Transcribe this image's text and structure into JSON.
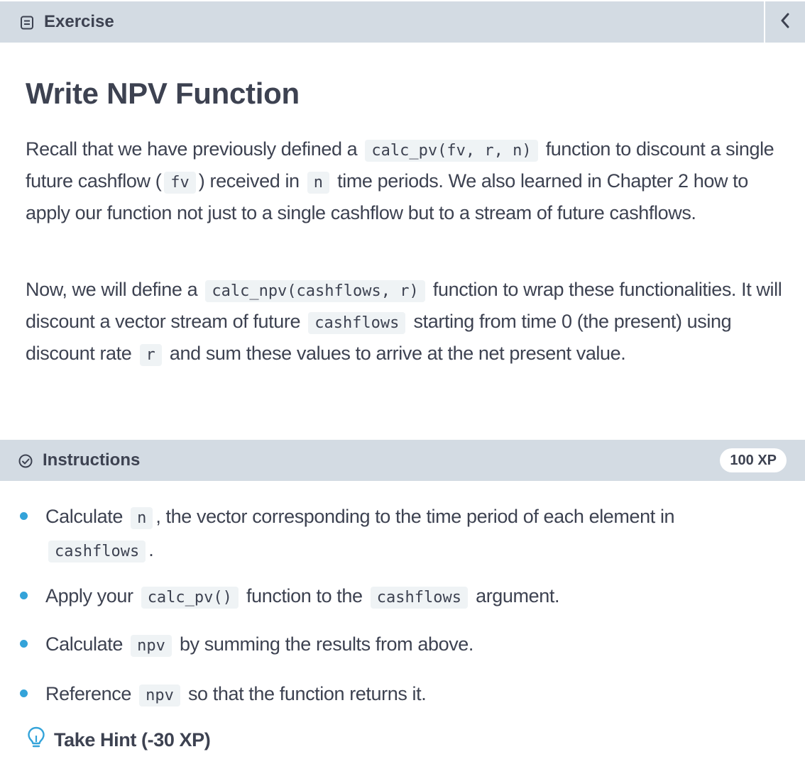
{
  "exercise_bar": {
    "label": "Exercise",
    "icon": "document-icon",
    "collapse_icon": "chevron-left-icon"
  },
  "title": "Write NPV Function",
  "paragraph1": {
    "t1": "Recall that we have previously defined a",
    "c1": "calc_pv(fv, r, n)",
    "t2": "function to discount a single future cashflow (",
    "c2": "fv",
    "t3": ") received in",
    "c3": "n",
    "t4": "time periods. We also learned in Chapter 2 how to apply our function not just to a single cashflow but to a stream of future cashflows."
  },
  "paragraph2": {
    "t1": "Now, we will define a",
    "c1": "calc_npv(cashflows, r)",
    "t2": "function to wrap these functionalities. It will discount a vector stream of future",
    "c2": "cashflows",
    "t3": "starting from time 0 (the present) using discount rate",
    "c3": "r",
    "t4": "and sum these values to arrive at the net present value."
  },
  "instructions_bar": {
    "label": "Instructions",
    "icon": "check-circle-icon",
    "xp": "100 XP"
  },
  "instructions": [
    {
      "t1": "Calculate",
      "c1": "n",
      "t2": ", the vector corresponding to the time period of each element in",
      "c2": "cashflows",
      "t3": "."
    },
    {
      "t1": "Apply your",
      "c1": "calc_pv()",
      "t2": "function to the",
      "c2": "cashflows",
      "t3": "argument."
    },
    {
      "t1": "Calculate",
      "c1": "npv",
      "t2": "by summing the results from above."
    },
    {
      "t1": "Reference",
      "c1": "npv",
      "t2": "so that the function returns it."
    }
  ],
  "hint": {
    "label": "Take Hint (-30 XP)",
    "icon": "lightbulb-icon"
  },
  "colors": {
    "bar_bg": "#d3dbe3",
    "text": "#3d4251",
    "bullet": "#33a3d9",
    "code_bg": "#eff3f5"
  }
}
